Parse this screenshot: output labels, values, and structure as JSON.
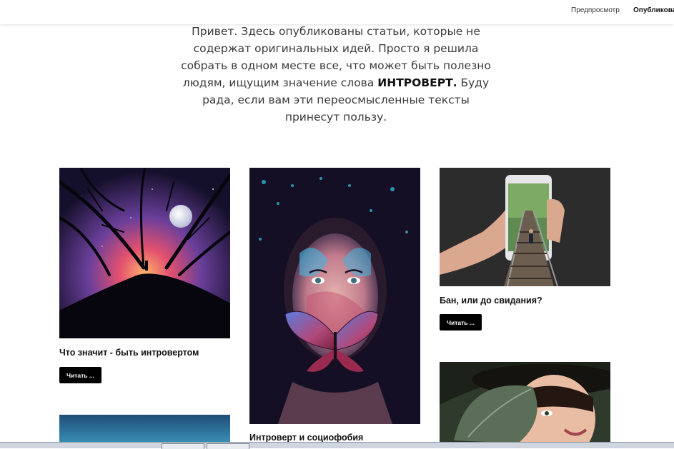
{
  "topbar": {
    "preview_label": "Предпросмотр",
    "publish_label": "Опубликовать"
  },
  "intro": {
    "text_before": "Привет. Здесь опубликованы статьи, которые не содержат оригинальных идей. Просто я решила собрать в одном месте все, что может быть полезно людям, ищущим значение слова ",
    "bold_word": "ИНТРОВЕРТ.",
    "text_after": " Буду рада, если вам эти переосмысленные тексты принесут пользу."
  },
  "cards": [
    {
      "title": "Что значит - быть интровертом",
      "button": "Читать ..."
    },
    {
      "title": "Интроверт и социофобия"
    },
    {
      "title": "Бан, или до свидания?",
      "button": "Читать ..."
    }
  ],
  "colors": {
    "button_bg": "#000000",
    "button_text": "#ffffff",
    "title_text": "#111111",
    "intro_text": "#3a3a3a"
  }
}
